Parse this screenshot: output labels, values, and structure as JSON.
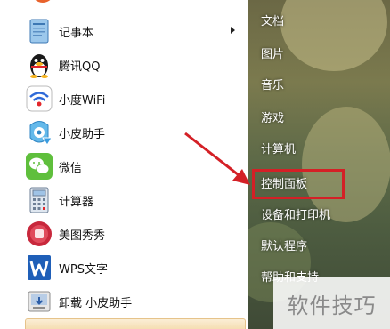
{
  "left_menu": {
    "items": [
      {
        "label": "记事本",
        "icon": "notepad-icon",
        "has_submenu": true
      },
      {
        "label": "腾讯QQ",
        "icon": "qq-penguin-icon"
      },
      {
        "label": "小度WiFi",
        "icon": "wifi-icon"
      },
      {
        "label": "小皮助手",
        "icon": "xiaopi-assistant-icon"
      },
      {
        "label": "微信",
        "icon": "wechat-icon"
      },
      {
        "label": "计算器",
        "icon": "calculator-icon"
      },
      {
        "label": "美图秀秀",
        "icon": "meitu-icon"
      },
      {
        "label": "WPS文字",
        "icon": "wps-writer-icon"
      },
      {
        "label": "卸载 小皮助手",
        "icon": "uninstall-icon"
      }
    ]
  },
  "right_menu": {
    "items": [
      {
        "label": "文档"
      },
      {
        "label": "图片"
      },
      {
        "label": "音乐"
      },
      {
        "label": "游戏"
      },
      {
        "label": "计算机"
      },
      {
        "label": "控制面板",
        "highlighted": true
      },
      {
        "label": "设备和打印机"
      },
      {
        "label": "默认程序"
      },
      {
        "label": "帮助和支持"
      }
    ]
  },
  "annotation": {
    "highlight_color": "#d42026",
    "target": "控制面板"
  },
  "watermark": {
    "text": "软件技巧"
  }
}
